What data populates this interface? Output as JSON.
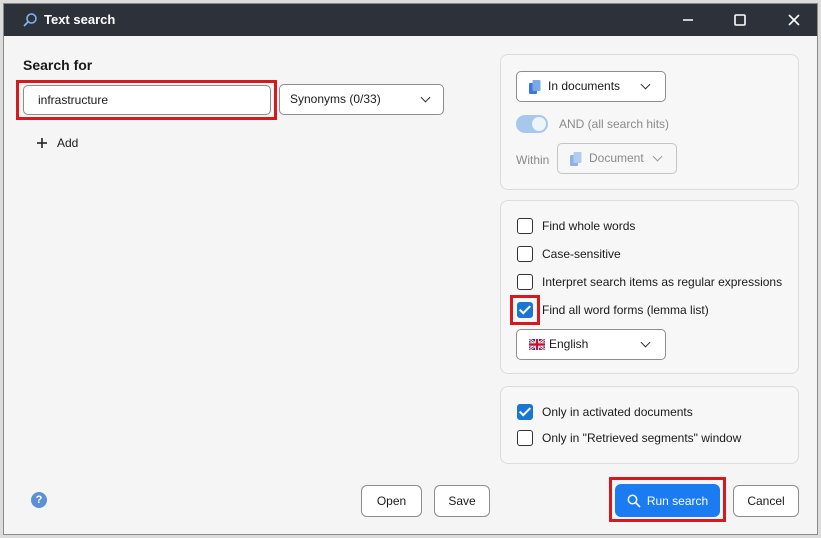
{
  "window": {
    "title": "Text search"
  },
  "search": {
    "heading": "Search for",
    "value": "infrastructure",
    "synonyms": "Synonyms (0/33)",
    "add_label": "Add"
  },
  "scope": {
    "in_documents": "In documents",
    "and_label": "AND (all search hits)",
    "within_label": "Within",
    "document": "Document"
  },
  "options": {
    "whole_words": {
      "label": "Find whole words",
      "checked": false
    },
    "case_sensitive": {
      "label": "Case-sensitive",
      "checked": false
    },
    "regex": {
      "label": "Interpret search items as regular expressions",
      "checked": false
    },
    "word_forms": {
      "label": "Find all word forms (lemma list)",
      "checked": true
    },
    "language": "English"
  },
  "filters": {
    "activated": {
      "label": "Only in activated documents",
      "checked": true
    },
    "retrieved": {
      "label": "Only in \"Retrieved segments\" window",
      "checked": false
    }
  },
  "footer": {
    "help": "?",
    "open": "Open",
    "save": "Save",
    "run": "Run search",
    "cancel": "Cancel"
  },
  "colors": {
    "accent": "#1a7cf0",
    "highlight": "#d5191d",
    "titlebar": "#2d3139"
  }
}
